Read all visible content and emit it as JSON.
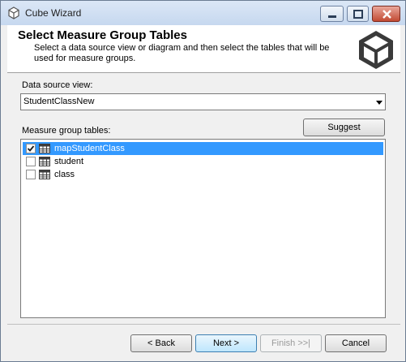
{
  "window": {
    "title": "Cube Wizard"
  },
  "header": {
    "title": "Select Measure Group Tables",
    "description": "Select a data source view or diagram and then select the tables that will be used for measure groups."
  },
  "data_source_view": {
    "label": "Data source view:",
    "selected": "StudentClassNew"
  },
  "measure_group_tables": {
    "label": "Measure group tables:",
    "suggest_label": "Suggest",
    "rows": [
      {
        "name": "mapStudentClass",
        "checked": true,
        "selected": true
      },
      {
        "name": "student",
        "checked": false,
        "selected": false
      },
      {
        "name": "class",
        "checked": false,
        "selected": false
      }
    ]
  },
  "footer": {
    "back_label": "< Back",
    "next_label": "Next >",
    "finish_label": "Finish >>|",
    "cancel_label": "Cancel"
  },
  "icons": {
    "app": "cube-icon",
    "header": "cube-logo-icon",
    "table": "table-icon",
    "minimize": "minimize-icon",
    "maximize": "maximize-icon",
    "close": "close-icon"
  },
  "colors": {
    "selection": "#3399ff",
    "close_button": "#c24a33"
  }
}
